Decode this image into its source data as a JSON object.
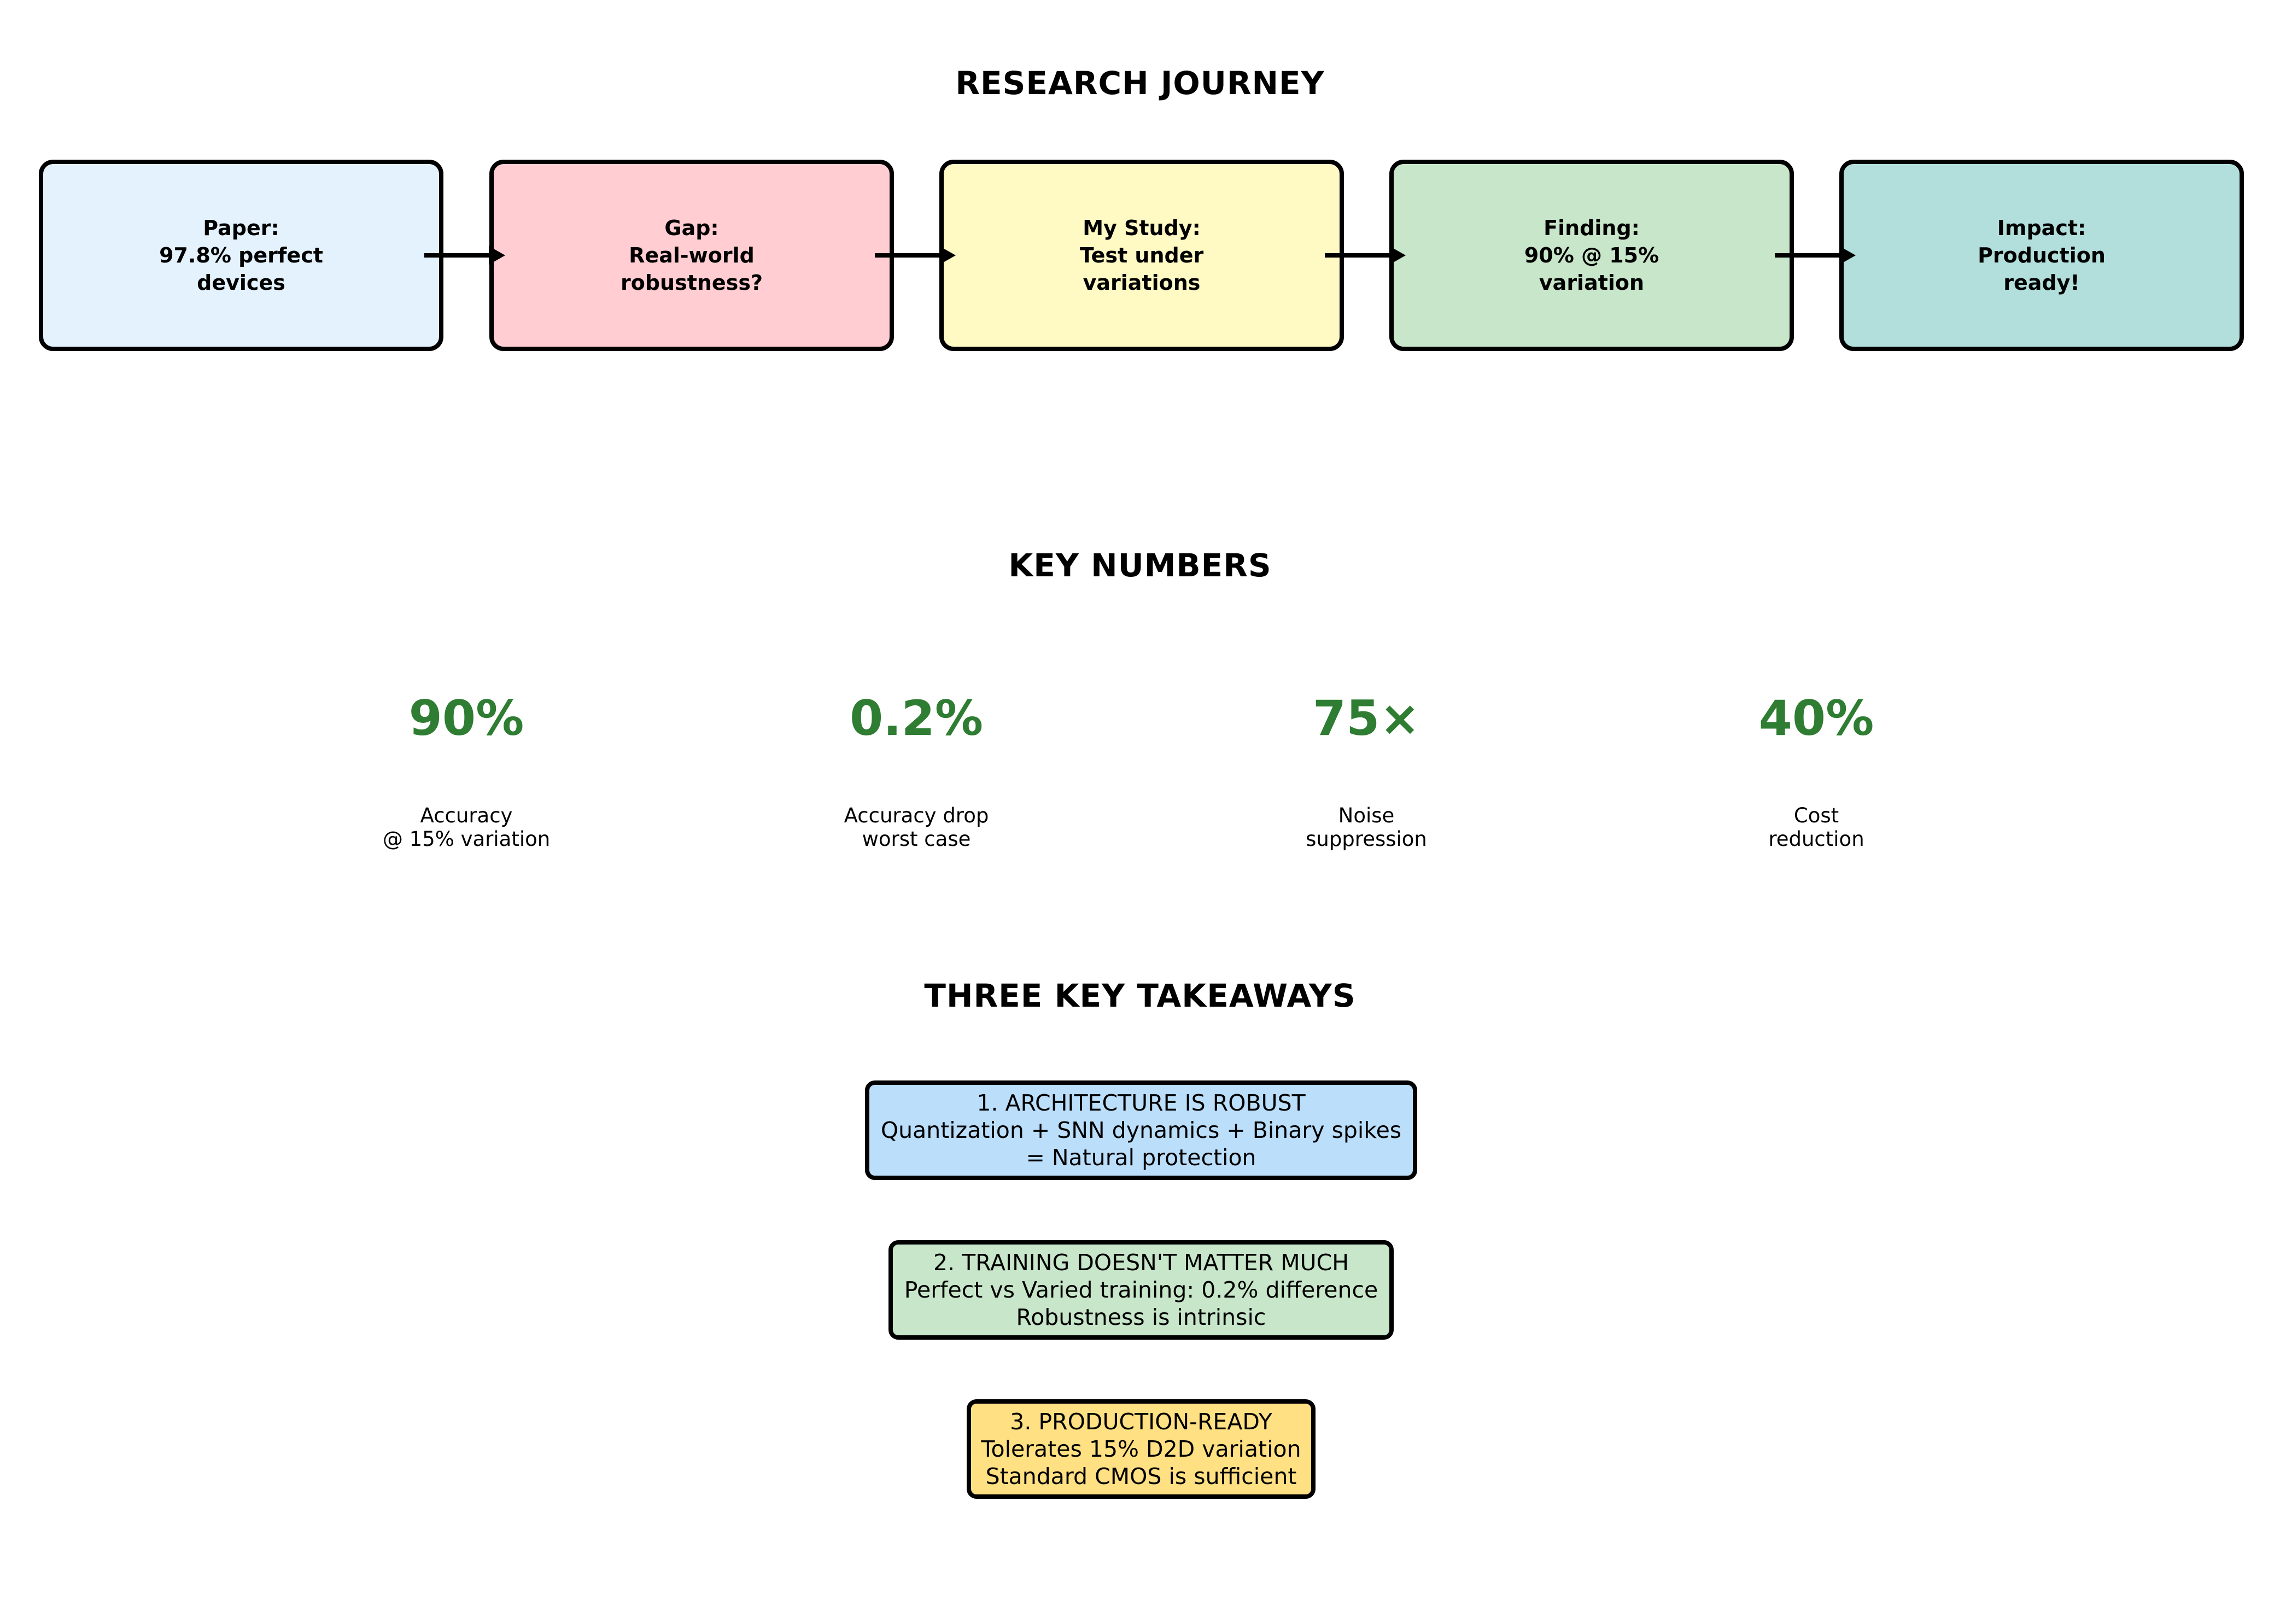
{
  "journey": {
    "title": "RESEARCH JOURNEY",
    "stages": [
      {
        "label": "Paper:\n97.8% perfect\ndevices",
        "color": "#e3f2fd"
      },
      {
        "label": "Gap:\nReal-world\nrobustness?",
        "color": "#ffcdd2"
      },
      {
        "label": "My Study:\nTest under\nvariations",
        "color": "#fff9c4"
      },
      {
        "label": "Finding:\n90% @ 15%\nvariation",
        "color": "#c8e6c9"
      },
      {
        "label": "Impact:\nProduction\nready!",
        "color": "#b2dfdb"
      }
    ]
  },
  "key_numbers": {
    "title": "KEY NUMBERS",
    "value_color": "#2e7d32",
    "items": [
      {
        "value": "90%",
        "label": "Accuracy\n@ 15% variation"
      },
      {
        "value": "0.2%",
        "label": "Accuracy drop\nworst case"
      },
      {
        "value": "75×",
        "label": "Noise\nsuppression"
      },
      {
        "value": "40%",
        "label": "Cost\nreduction"
      }
    ]
  },
  "takeaways": {
    "title": "THREE KEY TAKEAWAYS",
    "items": [
      {
        "lines": [
          "1. ARCHITECTURE IS ROBUST",
          "Quantization + SNN dynamics + Binary spikes",
          "= Natural protection"
        ],
        "color": "#bbdefb"
      },
      {
        "lines": [
          "2. TRAINING DOESN'T MATTER MUCH",
          "Perfect vs Varied training: 0.2% difference",
          "Robustness is intrinsic"
        ],
        "color": "#c8e6c9"
      },
      {
        "lines": [
          "3. PRODUCTION-READY",
          "Tolerates 15% D2D variation",
          "Standard CMOS is sufficient"
        ],
        "color": "#ffe082"
      }
    ]
  }
}
